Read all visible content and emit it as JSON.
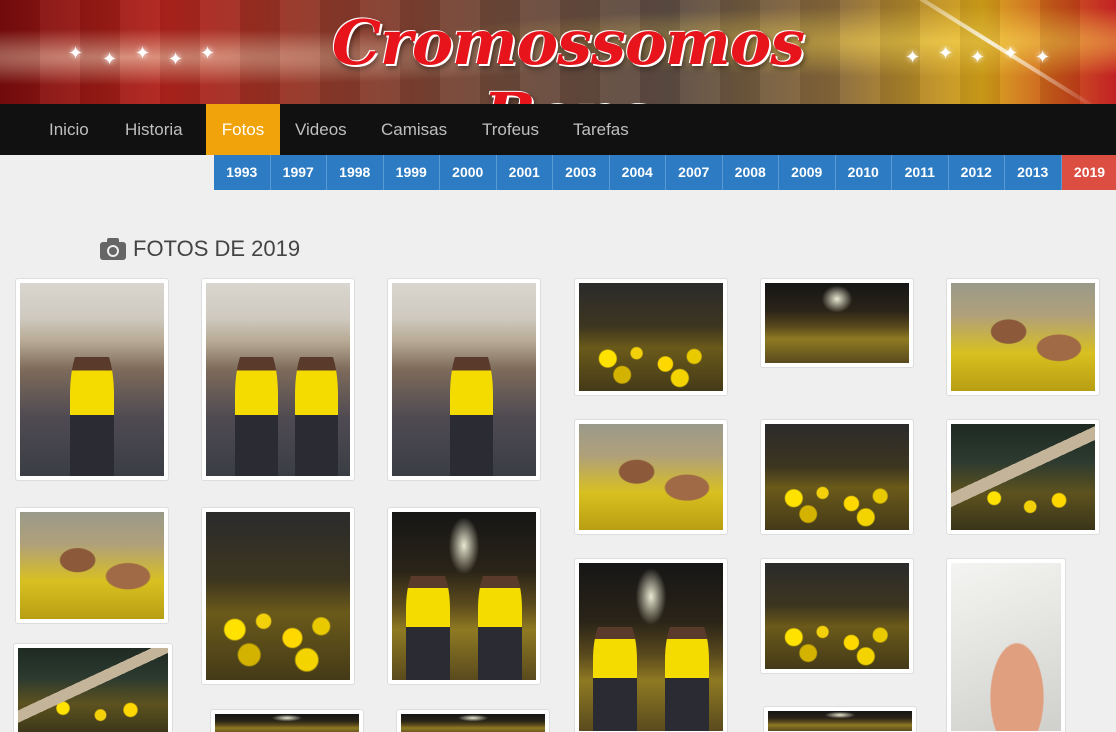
{
  "banner": {
    "title": "Cromossomos Bons"
  },
  "nav": {
    "items": [
      {
        "label": "Inicio",
        "active": false
      },
      {
        "label": "Historia",
        "active": false
      },
      {
        "label": "Fotos",
        "active": true
      },
      {
        "label": "Videos",
        "active": false
      },
      {
        "label": "Camisas",
        "active": false
      },
      {
        "label": "Trofeus",
        "active": false
      },
      {
        "label": "Tarefas",
        "active": false
      }
    ]
  },
  "years": {
    "items": [
      "1993",
      "1997",
      "1998",
      "1999",
      "2000",
      "2001",
      "2003",
      "2004",
      "2007",
      "2008",
      "2009",
      "2010",
      "2011",
      "2012",
      "2013",
      "2019"
    ],
    "active": "2019"
  },
  "section": {
    "title": "FOTOS DE 2019",
    "icon": "camera-icon"
  },
  "colors": {
    "nav_bg": "#111111",
    "nav_active": "#f0a30a",
    "year_bg": "#2d7cc3",
    "year_active": "#dc4e41",
    "page_bg": "#efefef"
  },
  "photos": [
    {
      "name": "photo-1",
      "scene": "indoor"
    },
    {
      "name": "photo-2",
      "scene": "indoor"
    },
    {
      "name": "photo-3",
      "scene": "indoor"
    },
    {
      "name": "photo-4",
      "scene": "night"
    },
    {
      "name": "photo-5",
      "scene": "night"
    },
    {
      "name": "photo-6",
      "scene": "selfie"
    },
    {
      "name": "photo-7",
      "scene": "selfie"
    },
    {
      "name": "photo-8",
      "scene": "crowd"
    },
    {
      "name": "photo-9",
      "scene": "crowd"
    },
    {
      "name": "photo-10",
      "scene": "crowd"
    },
    {
      "name": "photo-11",
      "scene": "selfie"
    },
    {
      "name": "photo-12",
      "scene": "night"
    },
    {
      "name": "photo-13",
      "scene": "night"
    },
    {
      "name": "photo-14",
      "scene": "night"
    },
    {
      "name": "photo-15",
      "scene": "hand"
    },
    {
      "name": "photo-16",
      "scene": "tent"
    },
    {
      "name": "photo-17",
      "scene": "night"
    },
    {
      "name": "photo-18",
      "scene": "night"
    },
    {
      "name": "photo-19",
      "scene": "night"
    }
  ]
}
